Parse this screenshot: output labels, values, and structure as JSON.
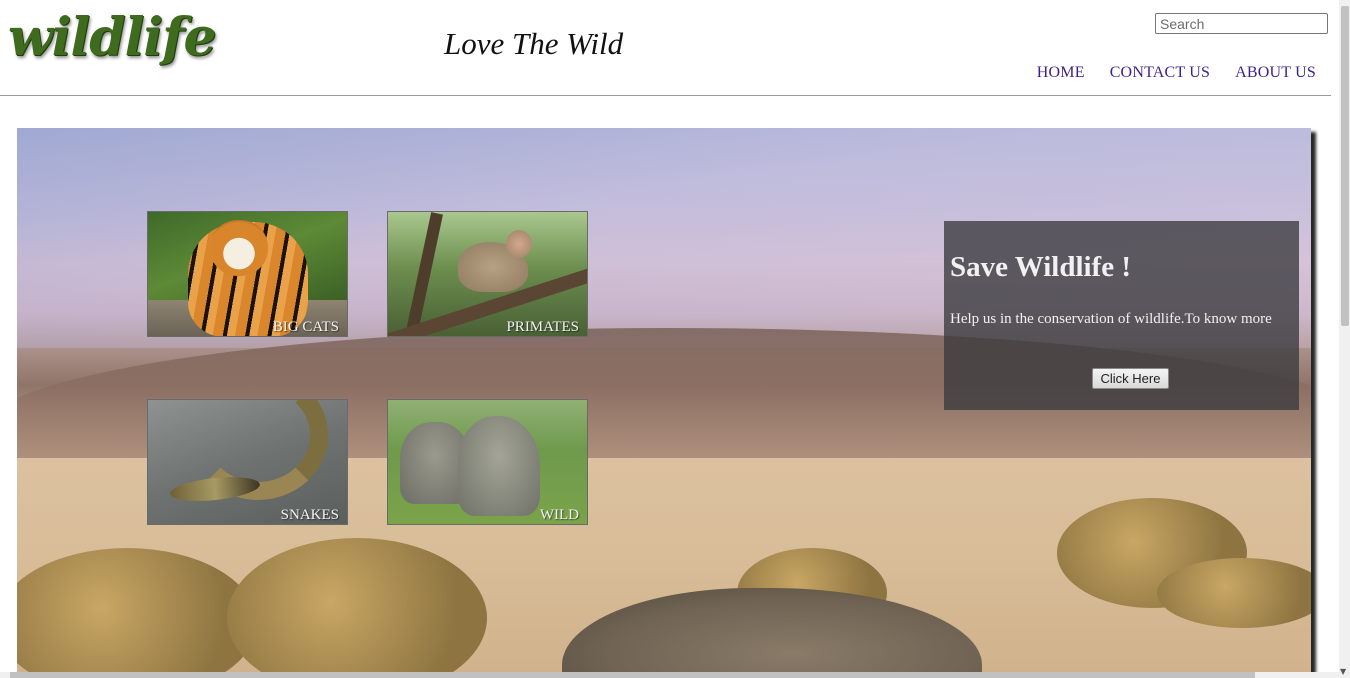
{
  "header": {
    "logo_text": "wildlife",
    "tagline": "Love The Wild",
    "search_placeholder": "Search",
    "nav": [
      {
        "label": "HOME"
      },
      {
        "label": "CONTACT US"
      },
      {
        "label": "ABOUT US"
      }
    ]
  },
  "categories": [
    {
      "label": "BIG CATS",
      "icon": "tiger-image"
    },
    {
      "label": "PRIMATES",
      "icon": "monkey-image"
    },
    {
      "label": "SNAKES",
      "icon": "snake-image"
    },
    {
      "label": "WILD",
      "icon": "elephant-image"
    }
  ],
  "info_panel": {
    "title": "Save Wildlife !",
    "text": "Help us in the conservation of wildlife.To know more",
    "button_label": "Click Here"
  },
  "colors": {
    "nav_link": "#3e1f8c",
    "logo_green": "#3f6b1e",
    "panel_bg": "rgba(58,58,62,0.78)"
  }
}
